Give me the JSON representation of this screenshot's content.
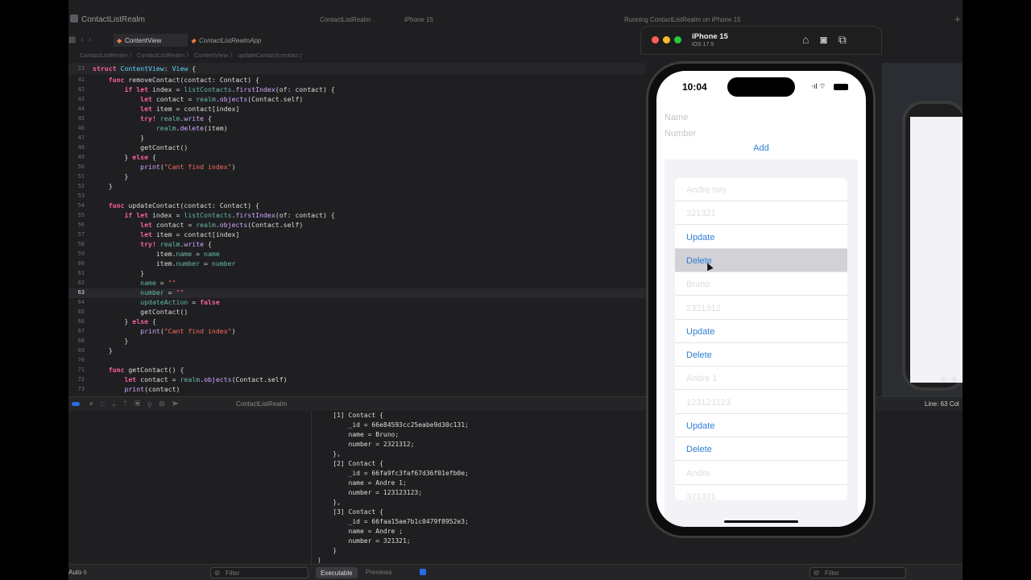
{
  "window": {
    "project_name": "ContactListRealm",
    "scheme": "ContactListRealm",
    "device": "iPhone 15",
    "status": "Running ContactListRealm on iPhone 15"
  },
  "tabs": [
    {
      "label": "ContentView"
    },
    {
      "label": "ContactListRealmApp"
    }
  ],
  "jumpbar": "ContactListRealm 〉 ContactListRealm 〉 ContentView 〉 updateContact(contact:)",
  "editor": {
    "sticky_line_number": "23",
    "sticky_text": "struct ContentView: View {",
    "current_line": "63",
    "lines": [
      {
        "n": "41",
        "t": "    func removeContact(contact: Contact) {"
      },
      {
        "n": "42",
        "t": "        if let index = listContacts.firstIndex(of: contact) {"
      },
      {
        "n": "43",
        "t": "            let contact = realm.objects(Contact.self)"
      },
      {
        "n": "44",
        "t": "            let item = contact[index]"
      },
      {
        "n": "45",
        "t": "            try! realm.write {"
      },
      {
        "n": "46",
        "t": "                realm.delete(item)"
      },
      {
        "n": "47",
        "t": "            }"
      },
      {
        "n": "48",
        "t": "            getContact()"
      },
      {
        "n": "49",
        "t": "        } else {"
      },
      {
        "n": "50",
        "t": "            print(\"Cant find index\")"
      },
      {
        "n": "51",
        "t": "        }"
      },
      {
        "n": "52",
        "t": "    }"
      },
      {
        "n": "53",
        "t": ""
      },
      {
        "n": "54",
        "t": "    func updateContact(contact: Contact) {"
      },
      {
        "n": "55",
        "t": "        if let index = listContacts.firstIndex(of: contact) {"
      },
      {
        "n": "56",
        "t": "            let contact = realm.objects(Contact.self)"
      },
      {
        "n": "57",
        "t": "            let item = contact[index]"
      },
      {
        "n": "58",
        "t": "            try! realm.write {"
      },
      {
        "n": "59",
        "t": "                item.name = name"
      },
      {
        "n": "60",
        "t": "                item.number = number"
      },
      {
        "n": "61",
        "t": "            }"
      },
      {
        "n": "62",
        "t": "            name = \"\""
      },
      {
        "n": "63",
        "t": "            number = \"\""
      },
      {
        "n": "64",
        "t": "            updateAction = false"
      },
      {
        "n": "65",
        "t": "            getContact()"
      },
      {
        "n": "66",
        "t": "        } else {"
      },
      {
        "n": "67",
        "t": "            print(\"Cant find index\")"
      },
      {
        "n": "68",
        "t": "        }"
      },
      {
        "n": "69",
        "t": "    }"
      },
      {
        "n": "70",
        "t": ""
      },
      {
        "n": "71",
        "t": "    func getContact() {"
      },
      {
        "n": "72",
        "t": "        let contact = realm.objects(Contact.self)"
      },
      {
        "n": "73",
        "t": "        print(contact)"
      }
    ]
  },
  "debug": {
    "target": "ContactListRealm",
    "status_line": "Line: 63  Col"
  },
  "console": [
    "    [1] Contact {",
    "        _id = 66e84593cc25eabe9d30c131;",
    "        name = Bruno;",
    "        number = 2321312;",
    "    },",
    "    [2] Contact {",
    "        _id = 66fa9fc3faf67d36f01efb0e;",
    "        name = Andre 1;",
    "        number = 123123123;",
    "    },",
    "    [3] Contact {",
    "        _id = 66faa15ae7b1c0479f8952e3;",
    "        name = Andre ;",
    "        number = 321321;",
    "    }",
    ")"
  ],
  "bottom": {
    "auto": "Auto ◊",
    "filter_left": "Filter",
    "executable": "Executable",
    "previews": "Previews",
    "filter_right": "Filter"
  },
  "simulator": {
    "title": "iPhone 15",
    "subtitle": "iOS 17.5",
    "time": "10:04",
    "name_placeholder": "Name",
    "number_placeholder": "Number",
    "add_label": "Add",
    "rows": [
      {
        "text": "Andre two",
        "kind": "text"
      },
      {
        "text": "321321",
        "kind": "text"
      },
      {
        "text": "Update",
        "kind": "link"
      },
      {
        "text": "Delete",
        "kind": "link-hl"
      },
      {
        "text": "Bruno",
        "kind": "text"
      },
      {
        "text": "2321312",
        "kind": "text"
      },
      {
        "text": "Update",
        "kind": "link"
      },
      {
        "text": "Delete",
        "kind": "link"
      },
      {
        "text": "Andre 1",
        "kind": "text"
      },
      {
        "text": "123123123",
        "kind": "text"
      },
      {
        "text": "Update",
        "kind": "link"
      },
      {
        "text": "Delete",
        "kind": "link"
      },
      {
        "text": "Andre",
        "kind": "text"
      },
      {
        "text": "321321",
        "kind": "text"
      }
    ]
  },
  "colors": {
    "accent": "#2f7ed8",
    "editor_bg": "#1f1f22",
    "keyword": "#fc5fa3",
    "type": "#5dd8ff"
  }
}
